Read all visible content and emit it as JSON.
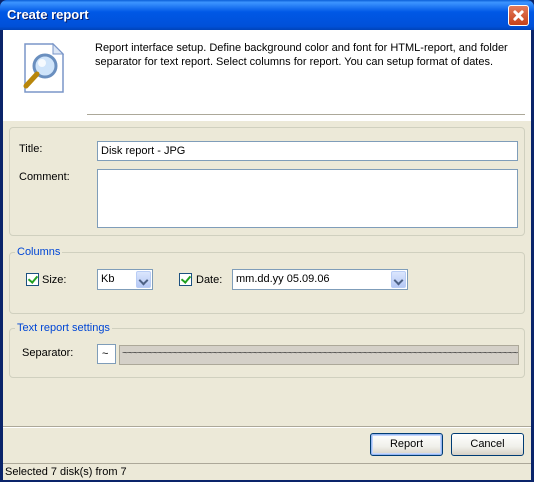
{
  "window": {
    "title": "Create report"
  },
  "header": {
    "icon": "report-search-icon",
    "description": "Report interface setup. Define background color and font for HTML-report, and folder separator for text report. Select columns for report. You can setup format of dates."
  },
  "general": {
    "title_label": "Title:",
    "title_value": "Disk report - JPG",
    "comment_label": "Comment:",
    "comment_value": ""
  },
  "columns": {
    "group_label": "Columns",
    "size": {
      "label": "Size:",
      "checked": true,
      "unit": "Kb"
    },
    "date": {
      "label": "Date:",
      "checked": true,
      "format": "mm.dd.yy 05.09.06"
    }
  },
  "text_report": {
    "group_label": "Text report settings",
    "separator_label": "Separator:",
    "separator_value": "~",
    "separator_preview": "~~~~~~~~~~~~~~~~~~~~~~~~~~~~~~~~~~~~~~~~~~~~~~~~~~~~~~~~~~~~~~~~~~~~~~~~~~~~~~~~~~~~~~~~~~~"
  },
  "buttons": {
    "report": "Report",
    "cancel": "Cancel"
  },
  "status": {
    "text": "Selected 7 disk(s) from 7"
  },
  "colors": {
    "title_bar": "#0058e6",
    "group_label": "#0046d5",
    "dialog_bg": "#ece9d8"
  }
}
